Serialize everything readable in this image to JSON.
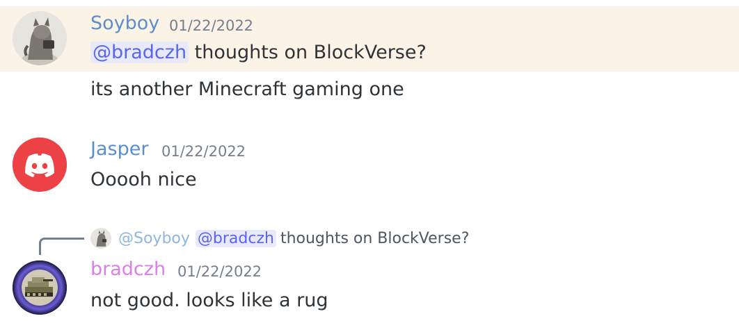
{
  "messages": [
    {
      "username": "Soyboy",
      "username_color": "#5b8fcb",
      "timestamp": "01/22/2022",
      "avatar": "cat-statue-avatar",
      "lines": [
        {
          "mention": "@bradczh",
          "text": "thoughts on BlockVerse?"
        },
        {
          "text": "its another Minecraft gaming one"
        }
      ],
      "highlighted": true,
      "highlight_color": "#fbf3e6"
    },
    {
      "username": "Jasper",
      "username_color": "#5b8fcb",
      "timestamp": "01/22/2022",
      "avatar": "discord-logo-avatar",
      "avatar_color": "#ed4245",
      "lines": [
        {
          "text": "Ooooh nice"
        }
      ]
    },
    {
      "reply": {
        "avatar": "cat-statue-avatar",
        "username": "@Soyboy",
        "mention": "@bradczh",
        "text": "thoughts on BlockVerse?"
      },
      "username": "bradczh",
      "username_color": "#dc7ee8",
      "timestamp": "01/22/2022",
      "avatar": "pixel-tank-avatar",
      "lines": [
        {
          "text": "not good. looks like a rug"
        }
      ]
    }
  ],
  "colors": {
    "mention_bg": "#e8e9fb",
    "mention_text": "#5865f2",
    "timestamp": "#747f8d",
    "message_text": "#2e3338"
  }
}
